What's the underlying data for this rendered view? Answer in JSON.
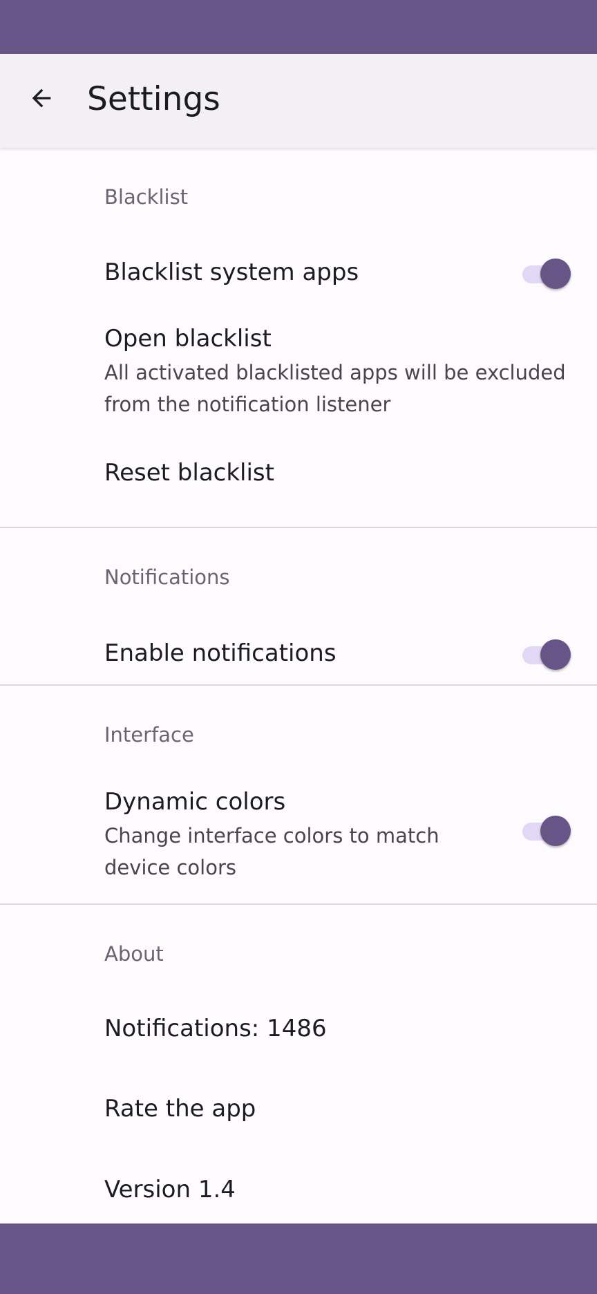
{
  "app_bar": {
    "title": "Settings",
    "back_icon": "arrow-back-icon"
  },
  "colors": {
    "primary": "#675588",
    "switch_track": "#e2d8f5",
    "surface": "#fdfbfe",
    "app_bar": "#f2eff5",
    "section_header": "#6a6374"
  },
  "sections": {
    "blacklist": {
      "header": "Blacklist",
      "system_apps": {
        "title": "Blacklist system apps",
        "enabled": true
      },
      "open": {
        "title": "Open blacklist",
        "summary": "All activated blacklisted apps will be excluded from the notification listener"
      },
      "reset": {
        "title": "Reset blacklist"
      }
    },
    "notifications": {
      "header": "Notifications",
      "enable": {
        "title": "Enable notifications",
        "enabled": true
      }
    },
    "interface": {
      "header": "Interface",
      "dynamic_colors": {
        "title": "Dynamic colors",
        "summary": "Change interface colors to match device colors",
        "enabled": true
      }
    },
    "about": {
      "header": "About",
      "notifications_count": {
        "title": "Notifications: 1486"
      },
      "rate": {
        "title": "Rate the app"
      },
      "version": {
        "title": "Version 1.4"
      }
    }
  }
}
